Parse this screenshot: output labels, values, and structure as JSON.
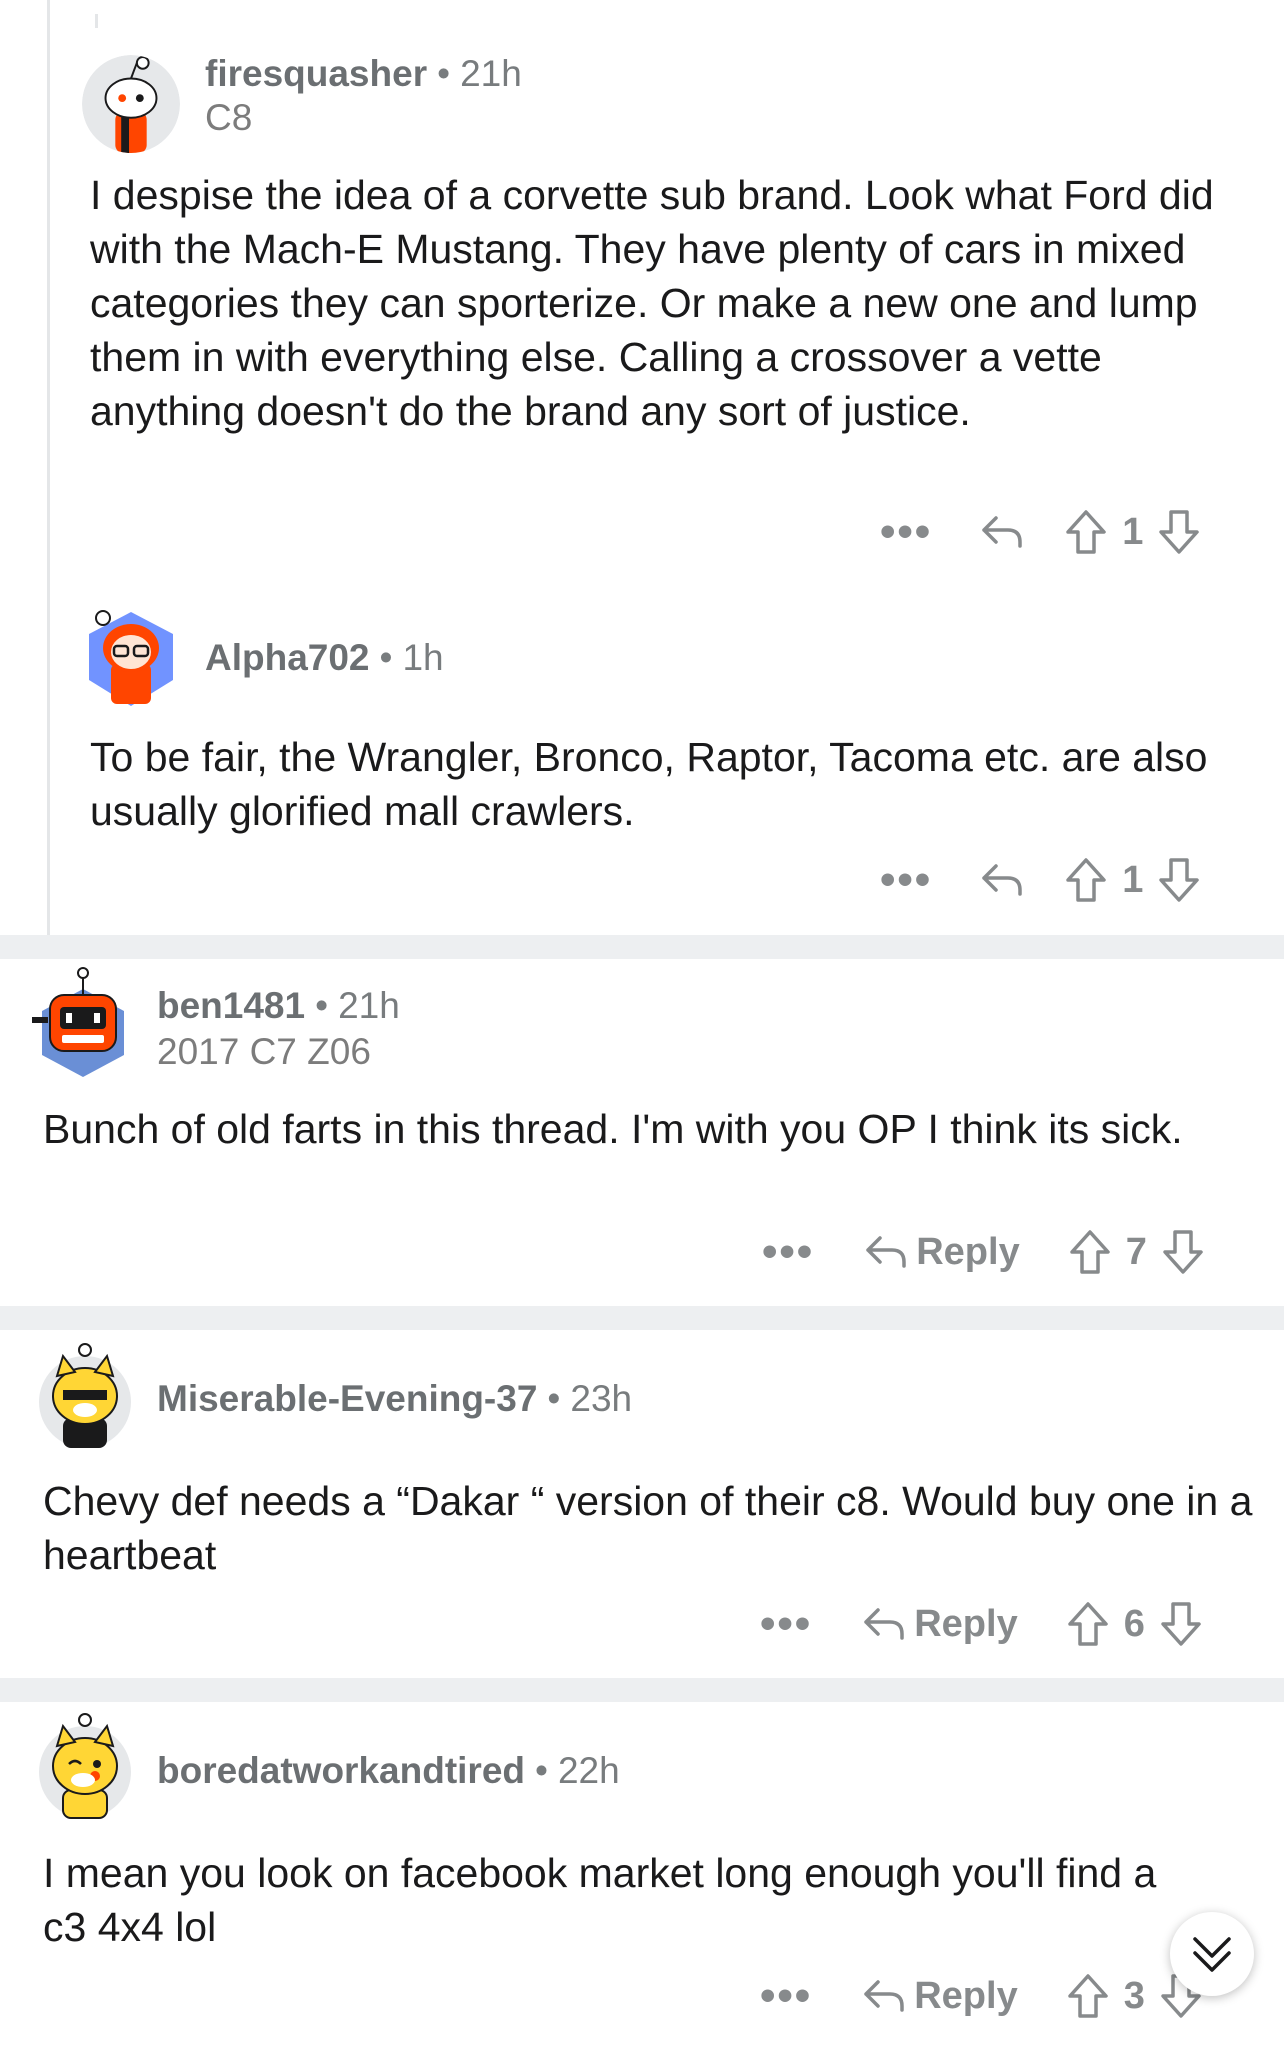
{
  "comments": [
    {
      "user": "firesquasher",
      "age": "21h",
      "flair": "C8",
      "body": "I despise the idea of a corvette sub brand. Look what Ford did with the Mach-E Mustang. They have plenty of cars in mixed categories they can sporterize. Or make a new one and lump them in with everything else. Calling a crossover a vette anything doesn't do the brand any sort of justice.",
      "more": "•••",
      "score": "1"
    },
    {
      "user": "Alpha702",
      "age": "1h",
      "body": "To be fair, the Wrangler, Bronco, Raptor, Tacoma etc. are also usually glorified mall crawlers.",
      "more": "•••",
      "score": "1"
    },
    {
      "user": "ben1481",
      "age": "21h",
      "flair": "2017 C7 Z06",
      "body": "Bunch of old farts in this thread. I'm with you OP I think its sick.",
      "more": "•••",
      "reply": "Reply",
      "score": "7"
    },
    {
      "user": "Miserable-Evening-37",
      "age": "23h",
      "body": "Chevy def needs a “Dakar “ version of their c8. Would buy one in a heartbeat",
      "more": "•••",
      "reply": "Reply",
      "score": "6"
    },
    {
      "user": "boredatworkandtired",
      "age": "22h",
      "body": "I mean you look on facebook market long enough you'll find a c3 4x4 lol",
      "more": "•••",
      "reply": "Reply",
      "score": "3"
    }
  ],
  "meta_separator": "•",
  "icons": {
    "reply": "reply-arrow-icon",
    "upvote": "upvote-arrow-icon",
    "downvote": "downvote-arrow-icon",
    "scroll": "double-chevron-down-icon"
  },
  "colors": {
    "meta_text": "#787c7e",
    "body_text": "#1a1a1b",
    "action_gray": "#878a8c",
    "separator": "#edeff1",
    "thread_line": "#e4e6e8"
  }
}
